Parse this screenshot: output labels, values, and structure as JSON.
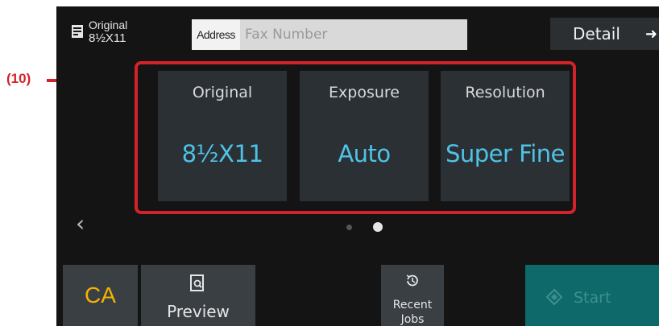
{
  "callout": {
    "label": "(10)"
  },
  "topbar": {
    "original_title": "Original",
    "original_size": "8½X11",
    "address_button": "Address",
    "fax_placeholder": "Fax Number",
    "detail_button": "Detail",
    "detail_arrow": "➜"
  },
  "settings": [
    {
      "label": "Original",
      "value": "8½X11"
    },
    {
      "label": "Exposure",
      "value": "Auto"
    },
    {
      "label": "Resolution",
      "value": "Super Fine"
    }
  ],
  "pager": {
    "prev": "‹",
    "page_count": 2,
    "active_page": 2
  },
  "bottombar": {
    "ca_button": "CA",
    "preview_button": "Preview",
    "recent_jobs_line1": "Recent",
    "recent_jobs_line2": "Jobs",
    "start_button": "Start"
  },
  "icons": {
    "original": "document-icon",
    "preview": "preview-icon",
    "recent_jobs": "history-icon",
    "start": "start-diamond-icon"
  },
  "colors": {
    "accent_value": "#4fc3e6",
    "ca_text": "#f5b301",
    "highlight": "#d2232a",
    "start_bg": "#0e6a6a"
  }
}
